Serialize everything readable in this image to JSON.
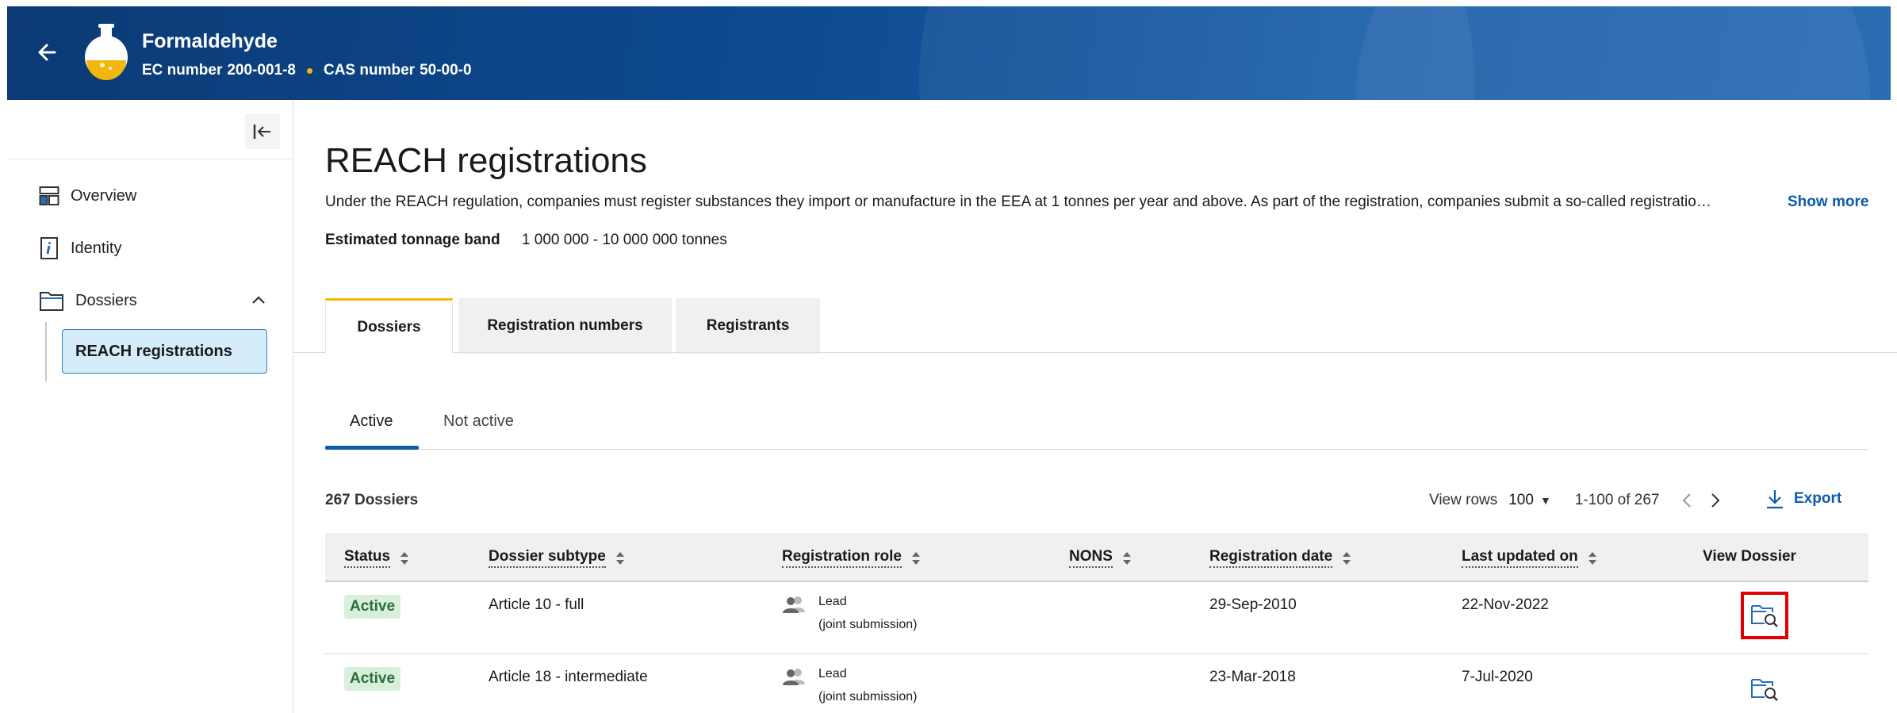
{
  "header": {
    "substance_name": "Formaldehyde",
    "ec_label": "EC number",
    "ec_value": "200-001-8",
    "cas_label": "CAS number",
    "cas_value": "50-00-0",
    "colors": {
      "banner": "#0d4a8f",
      "dot": "#f5b800"
    }
  },
  "sidebar": {
    "items": [
      {
        "label": "Overview",
        "icon": "overview-icon"
      },
      {
        "label": "Identity",
        "icon": "identity-icon"
      },
      {
        "label": "Dossiers",
        "icon": "folder-icon",
        "expanded": true
      }
    ],
    "sub_items": [
      {
        "label": "REACH registrations",
        "selected": true
      }
    ]
  },
  "main": {
    "title": "REACH registrations",
    "intro": "Under the REACH regulation, companies must register substances they import or manufacture in the EEA at 1 tonnes per year and above. As part of the registration, companies submit a so-called registratio…",
    "show_more": "Show more",
    "tonnage_label": "Estimated tonnage band",
    "tonnage_value": "1 000 000 - 10 000 000 tonnes",
    "tabs": [
      {
        "label": "Dossiers",
        "active": true
      },
      {
        "label": "Registration numbers",
        "active": false
      },
      {
        "label": "Registrants",
        "active": false
      }
    ],
    "subtabs": [
      {
        "label": "Active",
        "active": true
      },
      {
        "label": "Not active",
        "active": false
      }
    ],
    "count": "267 Dossiers",
    "pager": {
      "view_rows_label": "View rows",
      "rows_value": "100",
      "range": "1-100 of 267"
    },
    "export_label": "Export",
    "table": {
      "columns": [
        "Status",
        "Dossier subtype",
        "Registration role",
        "NONS",
        "Registration date",
        "Last updated on",
        "View Dossier"
      ],
      "rows": [
        {
          "status": "Active",
          "subtype": "Article 10 - full",
          "role_1": "Lead",
          "role_2": "(joint submission)",
          "nons": "",
          "reg_date": "29-Sep-2010",
          "updated": "22-Nov-2022",
          "highlighted": true
        },
        {
          "status": "Active",
          "subtype": "Article 18 - intermediate",
          "role_1": "Lead",
          "role_2": "(joint submission)",
          "nons": "",
          "reg_date": "23-Mar-2018",
          "updated": "7-Jul-2020",
          "highlighted": false
        }
      ]
    },
    "colors": {
      "link": "#0b5cad",
      "active_badge_bg": "#d8efdb",
      "active_badge_text": "#2d6e38",
      "highlight": "#e00000",
      "tab_accent": "#f5b800"
    }
  }
}
